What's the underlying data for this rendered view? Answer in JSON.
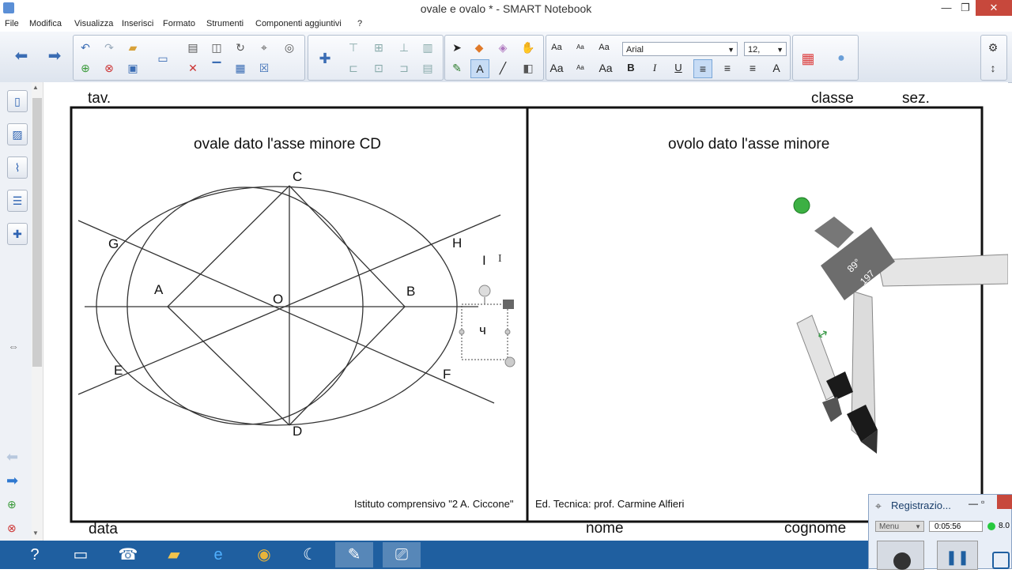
{
  "window": {
    "title": "ovale e ovalo * - SMART Notebook",
    "minimize": "—",
    "maximize": "❐",
    "close": "✕"
  },
  "menu": [
    "File",
    "Modifica",
    "Visualizza",
    "Inserisci",
    "Formato",
    "Strumenti",
    "Componenti aggiuntivi",
    "?"
  ],
  "toolbar": {
    "font_name": "Arial",
    "font_size": "12,",
    "aa_large": "Aa",
    "aa_small": "Aa",
    "bold": "B",
    "italic": "I",
    "underline": "U"
  },
  "page": {
    "header_left": "tav.",
    "header_classe": "classe",
    "header_sez": "sez.",
    "footer_data": "data",
    "footer_nome": "nome",
    "footer_cognome": "cognome",
    "left_title": "ovale dato l'asse minore CD",
    "right_title": "ovolo dato l'asse minore",
    "credit_left": "Istituto comprensivo \"2 A. Ciccone\"",
    "credit_right": "Ed. Tecnica: prof. Carmine Alfieri",
    "points": {
      "C": "C",
      "G": "G",
      "H": "H",
      "A": "A",
      "O": "O",
      "B": "B",
      "E": "E",
      "F": "F",
      "D": "D"
    },
    "text_box": "ч",
    "cursor_i": "I",
    "compass_angle": "89°",
    "compass_radius": "197"
  },
  "recorder": {
    "title": "Registrazio...",
    "menu_label": "Menu",
    "elapsed": "0:05:56",
    "rate": "8.0"
  },
  "colors": {
    "accent": "#3b6db4",
    "taskbar": "#1f5fa0",
    "compass_body": "#6d6d6d",
    "green_handle": "#3cb043"
  }
}
